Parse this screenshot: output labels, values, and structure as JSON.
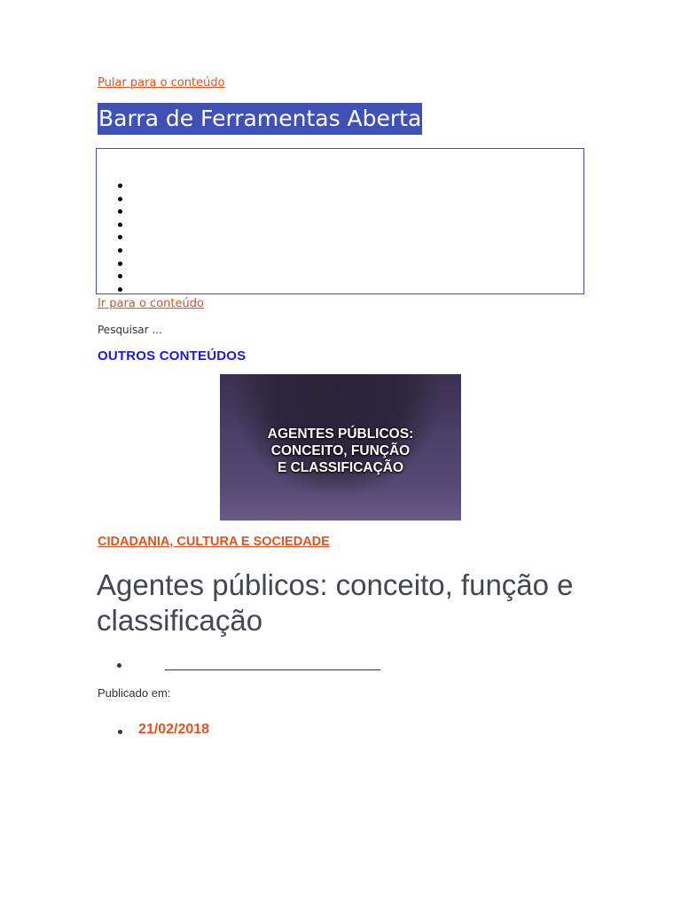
{
  "skip_link": "Pular para o conteúdo",
  "toolbar": {
    "title": "Barra de Ferramentas Aberta",
    "items_count_visible": 9,
    "accent_color": "#3f51b5"
  },
  "goto_content": "Ir para o conteúdo",
  "search": {
    "placeholder": "Pesquisar ..."
  },
  "sidebar": {
    "heading": "OUTROS CONTEÚDOS",
    "featured_image_text": {
      "line1": "AGENTES PÚBLICOS:",
      "line2": "CONCEITO, FUNÇÃO",
      "line3": "E CLASSIFICAÇÃO"
    }
  },
  "post": {
    "category": "CIDADANIA, CULTURA E SOCIEDADE",
    "title": "Agentes públicos: conceito, função e classificação",
    "published_label": "Publicado em:",
    "date": "21/02/2018"
  },
  "colors": {
    "link_orange": "#e0531f",
    "heading_blue": "#1a1ae0",
    "title_gray": "#444750"
  }
}
